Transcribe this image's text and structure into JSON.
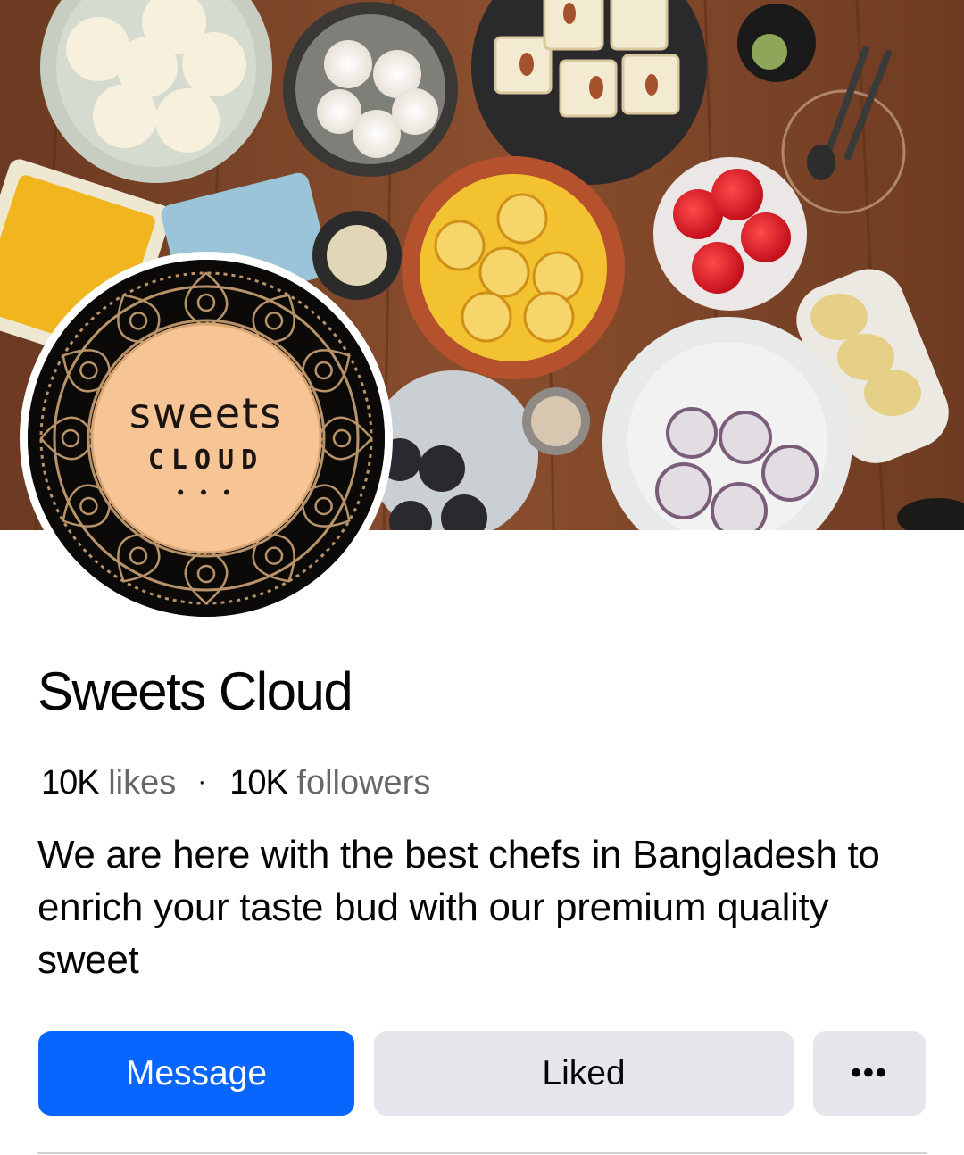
{
  "page": {
    "name": "Sweets Cloud",
    "likes_count": "10K",
    "likes_label": "likes",
    "separator": "·",
    "followers_count": "10K",
    "followers_label": "followers",
    "bio": "We are here with the best chefs in Bangladesh to enrich your taste bud with our premium quality sweet"
  },
  "logo": {
    "line1": "sweets",
    "line2": "CLOUD",
    "dots": "• • •"
  },
  "actions": {
    "message_label": "Message",
    "liked_label": "Liked",
    "more_label": "•••"
  },
  "colors": {
    "primary": "#0866ff",
    "secondary_button": "#e4e6eb",
    "logo_peach": "#f7c595",
    "logo_gold": "#b8936a"
  },
  "icons": {
    "more": "more-horizontal-icon"
  }
}
